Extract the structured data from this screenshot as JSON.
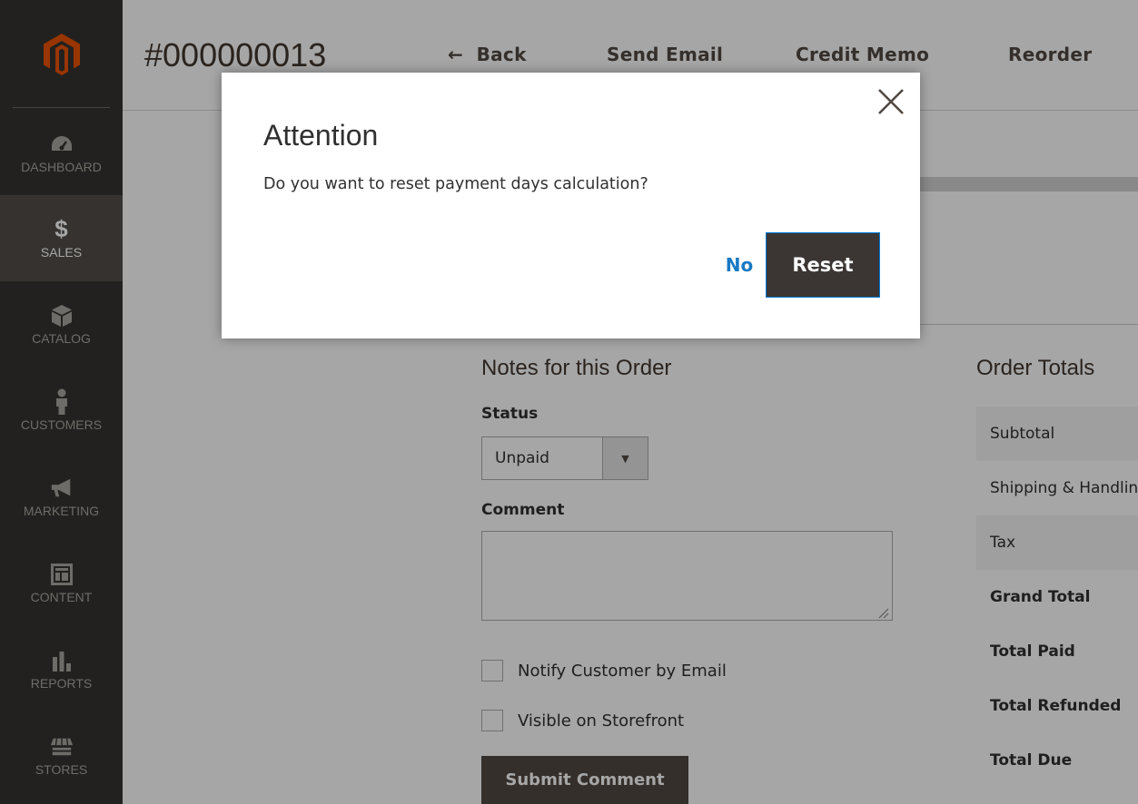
{
  "header": {
    "order_number": "#000000013",
    "back_label": "Back",
    "send_email_label": "Send Email",
    "credit_memo_label": "Credit Memo",
    "reorder_label": "Reorder"
  },
  "sidebar": {
    "items": [
      {
        "label": "DASHBOARD",
        "icon": "dashboard-icon"
      },
      {
        "label": "SALES",
        "icon": "dollar-icon",
        "active": true
      },
      {
        "label": "CATALOG",
        "icon": "cube-icon"
      },
      {
        "label": "CUSTOMERS",
        "icon": "person-icon"
      },
      {
        "label": "MARKETING",
        "icon": "megaphone-icon"
      },
      {
        "label": "CONTENT",
        "icon": "layout-icon"
      },
      {
        "label": "REPORTS",
        "icon": "bar-chart-icon"
      },
      {
        "label": "STORES",
        "icon": "store-icon"
      }
    ]
  },
  "notes": {
    "title": "Notes for this Order",
    "status_label": "Status",
    "status_value": "Unpaid",
    "comment_label": "Comment",
    "comment_value": "",
    "notify_label": "Notify Customer by Email",
    "visible_label": "Visible on Storefront",
    "submit_label": "Submit Comment"
  },
  "totals": {
    "title": "Order Totals",
    "rows": [
      "Subtotal",
      "Shipping & Handling",
      "Tax",
      "Grand Total",
      "Total Paid",
      "Total Refunded",
      "Total Due"
    ]
  },
  "modal": {
    "title": "Attention",
    "message": "Do you want to reset payment days calculation?",
    "no_label": "No",
    "reset_label": "Reset"
  },
  "colors": {
    "sidebar_bg": "#373330",
    "sidebar_active": "#524d49",
    "logo": "#eb5202",
    "link": "#1979c3",
    "primary_button": "#514943"
  }
}
